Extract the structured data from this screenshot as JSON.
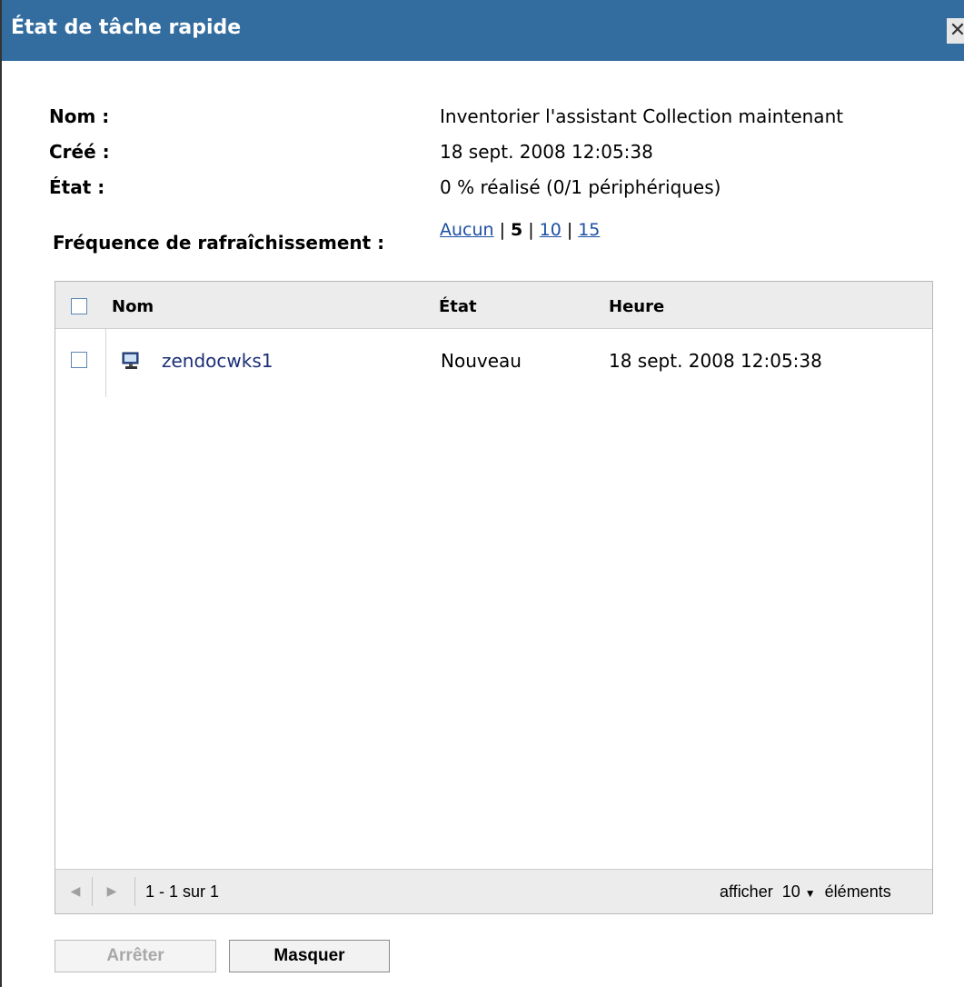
{
  "dialog": {
    "title": "État de tâche rapide",
    "close_glyph": "✕"
  },
  "info": {
    "name_label": "Nom :",
    "name_value": "Inventorier l'assistant Collection maintenant",
    "created_label": "Créé :",
    "created_value": "18 sept. 2008 12:05:38",
    "state_label": "État :",
    "state_value": "0 % réalisé (0/1 périphériques)"
  },
  "refresh": {
    "label": "Fréquence de rafraîchissement :",
    "options": [
      "Aucun",
      "5",
      "10",
      "15"
    ],
    "selected": "5",
    "separator": "|"
  },
  "table": {
    "columns": [
      "Nom",
      "État",
      "Heure"
    ],
    "rows": [
      {
        "icon": "desktop-computer-icon",
        "name": "zendocwks1",
        "state": "Nouveau",
        "time": "18 sept. 2008 12:05:38"
      }
    ],
    "pager": {
      "range": "1 - 1 sur 1",
      "show_prefix": "afficher",
      "page_size": "10",
      "show_suffix": "éléments"
    }
  },
  "buttons": {
    "stop": "Arrêter",
    "hide": "Masquer"
  },
  "colors": {
    "titlebar": "#336d9f",
    "link": "#1d4fa3",
    "device_link": "#1b2f78",
    "header_bg": "#ececec"
  }
}
